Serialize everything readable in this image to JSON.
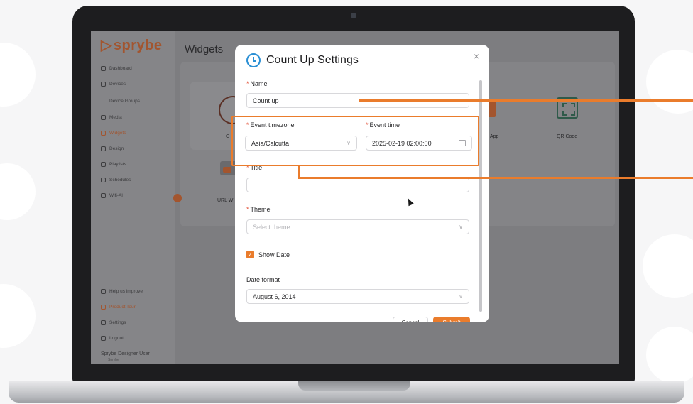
{
  "brand": {
    "name": "sprybe",
    "mark": "▷"
  },
  "page": {
    "title": "Widgets"
  },
  "sidebar": {
    "items": [
      {
        "label": "Dashboard"
      },
      {
        "label": "Devices"
      },
      {
        "label": "Device Groups"
      },
      {
        "label": "Media"
      },
      {
        "label": "Widgets"
      },
      {
        "label": "Design"
      },
      {
        "label": "Playlists"
      },
      {
        "label": "Schedules"
      },
      {
        "label": "Wifi-Al"
      }
    ],
    "bottom_items": [
      {
        "label": "Help us improve"
      },
      {
        "label": "Product Tour"
      },
      {
        "label": "Settings"
      },
      {
        "label": "Logout"
      }
    ],
    "user": {
      "name": "Sprybe Designer User",
      "role": "Sprybe"
    }
  },
  "widgets": {
    "items": [
      {
        "label": "C"
      },
      {
        "label": "App"
      },
      {
        "label": "QR Code"
      },
      {
        "label": "URL W"
      }
    ]
  },
  "modal": {
    "title": "Count Up Settings",
    "close_glyph": "×",
    "fields": {
      "name": {
        "label": "Name",
        "value": "Count up"
      },
      "timezone": {
        "label": "Event timezone",
        "value": "Asia/Calcutta"
      },
      "event_time": {
        "label": "Event time",
        "value": "2025-02-19 02:00:00"
      },
      "title": {
        "label": "Title",
        "value": ""
      },
      "theme": {
        "label": "Theme",
        "placeholder": "Select theme"
      },
      "show_date": {
        "label": "Show Date",
        "checked": true
      },
      "date_format": {
        "label": "Date format",
        "value": "August 6, 2014"
      }
    },
    "buttons": {
      "cancel": "Cancel",
      "submit": "Submit"
    }
  },
  "colors": {
    "accent": "#ea7c2c",
    "brand": "#a2552f",
    "icon_blue": "#2a8fd4"
  }
}
